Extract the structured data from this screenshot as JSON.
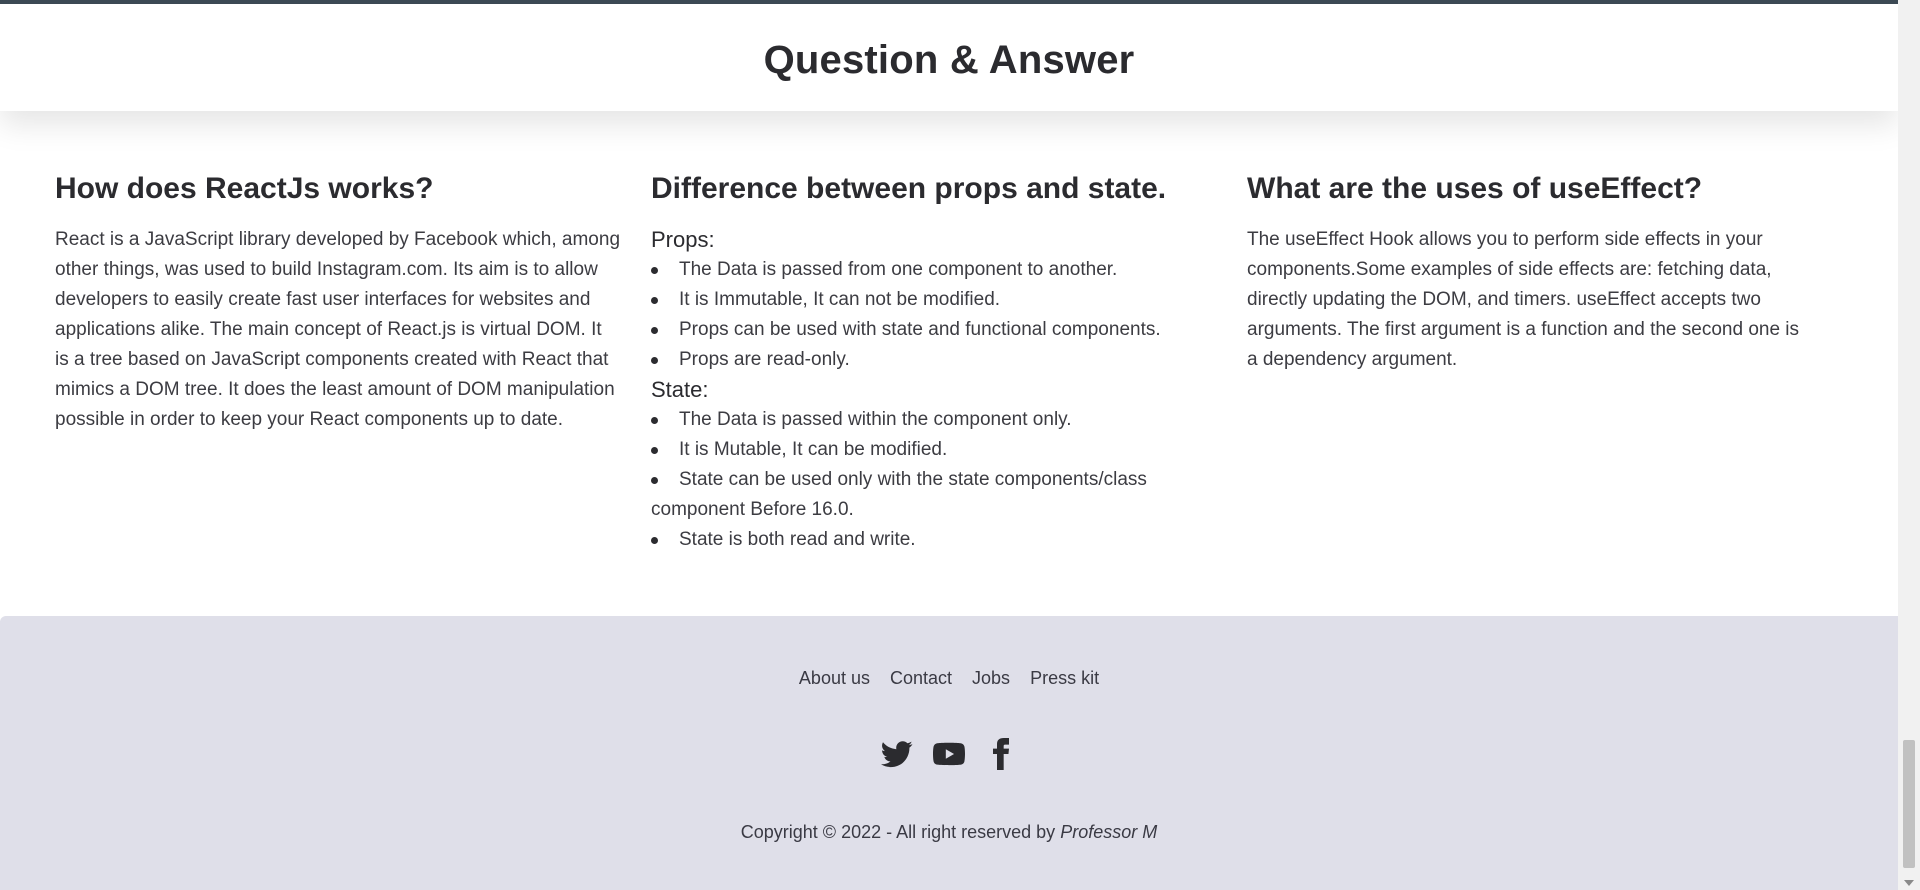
{
  "header": {
    "title": "Question & Answer"
  },
  "qa": {
    "react": {
      "heading": "How does ReactJs works?",
      "body": "React is a JavaScript library developed by Facebook which, among other things, was used to build Instagram.com. Its aim is to allow developers to easily create fast user interfaces for websites and applications alike. The main concept of React.js is virtual DOM. It is a tree based on JavaScript components created with React that mimics a DOM tree. It does the least amount of DOM manipulation possible in order to keep your React components up to date."
    },
    "props_state": {
      "heading": "Difference between props and state.",
      "props_label": "Props:",
      "props_items": [
        "The Data is passed from one component to another.",
        "It is Immutable, It can not be modified.",
        "Props can be used with state and functional components.",
        "Props are read-only."
      ],
      "state_label": "State:",
      "state_items": [
        "The Data is passed within the component only.",
        "It is Mutable, It can be modified.",
        "State can be used only with the state components/class component Before 16.0.",
        "State is both read and write."
      ]
    },
    "use_effect": {
      "heading": "What are the uses of useEffect?",
      "body": "The useEffect Hook allows you to perform side effects in your components.Some examples of side effects are: fetching data, directly updating the DOM, and timers. useEffect accepts two arguments. The first argument is a function and the second one is a dependency argument."
    }
  },
  "footer": {
    "links": [
      "About us",
      "Contact",
      "Jobs",
      "Press kit"
    ],
    "socials": [
      "twitter-icon",
      "youtube-icon",
      "facebook-icon"
    ],
    "copyright_prefix": "Copyright © 2022 - All right reserved by",
    "copyright_author": "Professor M",
    "background": "#dfdfe9"
  }
}
